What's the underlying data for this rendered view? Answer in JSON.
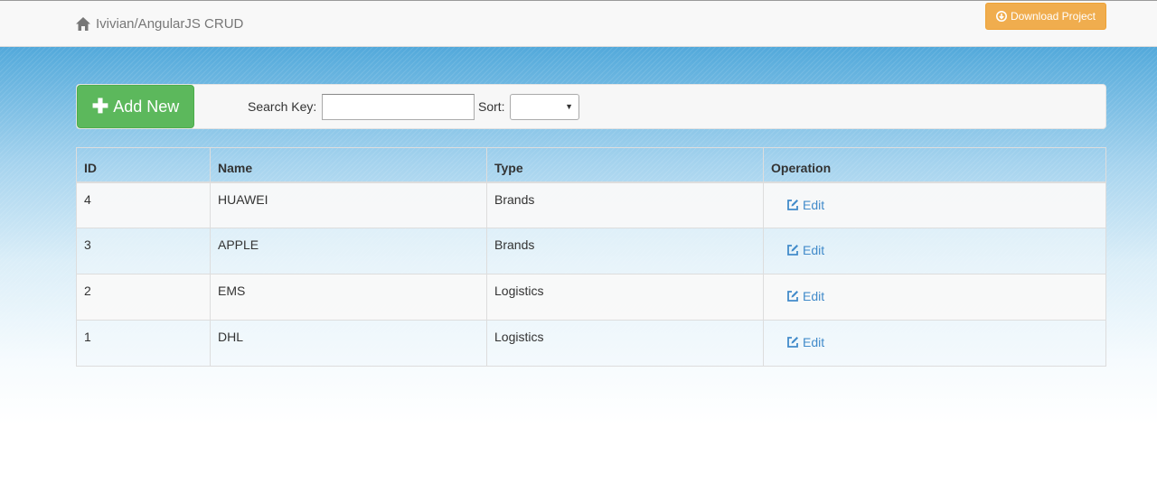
{
  "navbar": {
    "brand": "Ivivian/AngularJS CRUD",
    "download_label": "Download Project"
  },
  "toolbar": {
    "add_label": "Add New",
    "search_label": "Search Key:",
    "search_value": "",
    "sort_label": "Sort:",
    "sort_value": ""
  },
  "table": {
    "headers": [
      "ID",
      "Name",
      "Type",
      "Operation"
    ],
    "rows": [
      {
        "id": "4",
        "name": "HUAWEI",
        "type": "Brands",
        "operation": "Edit"
      },
      {
        "id": "3",
        "name": "APPLE",
        "type": "Brands",
        "operation": "Edit"
      },
      {
        "id": "2",
        "name": "EMS",
        "type": "Logistics",
        "operation": "Edit"
      },
      {
        "id": "1",
        "name": "DHL",
        "type": "Logistics",
        "operation": "Edit"
      }
    ]
  },
  "colors": {
    "primary_link": "#428bca",
    "success_button": "#5cb85c",
    "warning_button": "#f0ad4e",
    "background_top": "#2d8fcf"
  },
  "icons": {
    "brand": "home-icon",
    "download": "circle-arrow-down-icon",
    "add": "plus-icon",
    "edit": "edit-square-icon"
  }
}
